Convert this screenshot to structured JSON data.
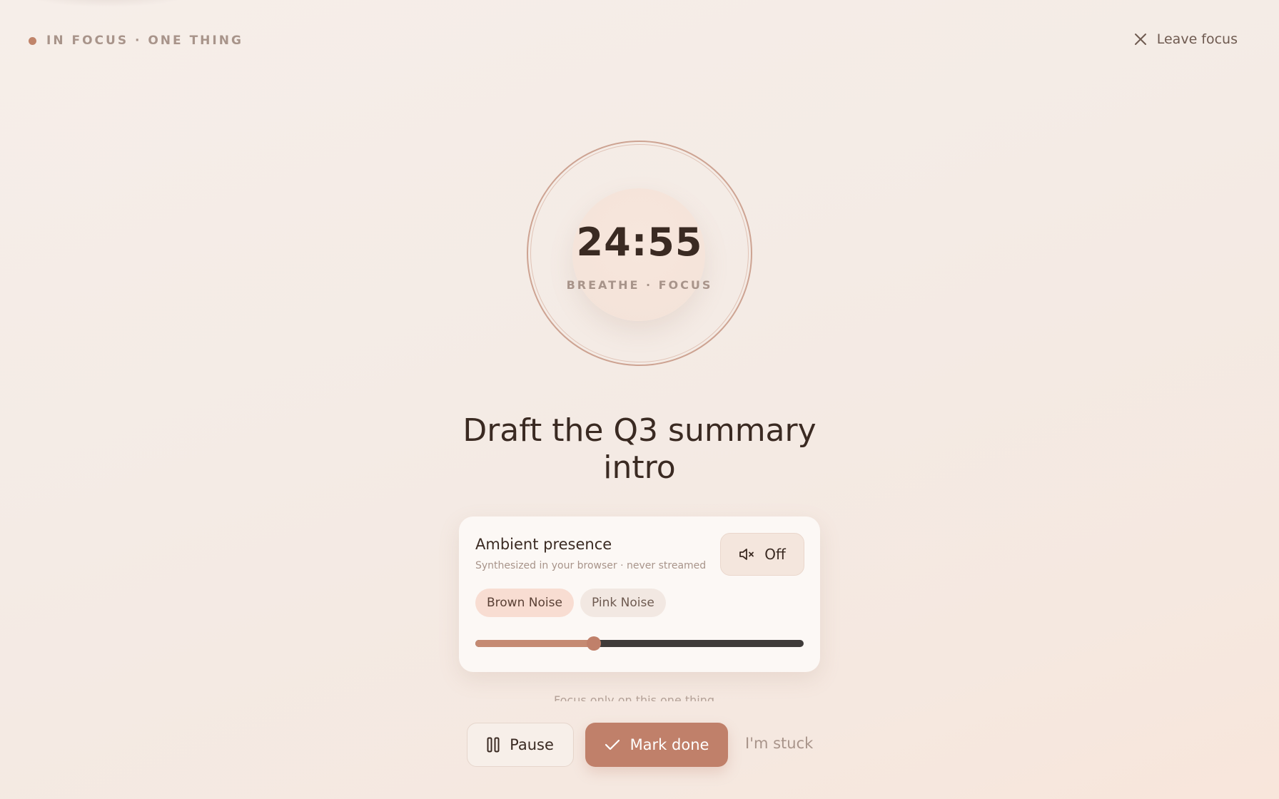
{
  "status": {
    "label": "IN FOCUS · ONE THING",
    "dot_color": "#c0846a"
  },
  "leave": {
    "label": "Leave focus",
    "icon": "close-icon"
  },
  "timer": {
    "time": "24:55",
    "subtitle": "BREATHE · FOCUS"
  },
  "task": {
    "title": "Draft the Q3 summary intro"
  },
  "ambient": {
    "title": "Ambient presence",
    "subtitle": "Synthesized in your browser · never streamed",
    "mute": {
      "label": "Off",
      "icon": "speaker-muted-icon"
    },
    "options": [
      {
        "label": "Brown Noise",
        "selected": true
      },
      {
        "label": "Pink Noise",
        "selected": false
      }
    ],
    "volume": 0.36
  },
  "hint": {
    "text": "Focus only on this one thing"
  },
  "actions": {
    "pause": {
      "label": "Pause",
      "icon": "pause-icon"
    },
    "done": {
      "label": "Mark done",
      "icon": "check-icon"
    },
    "stuck": {
      "label": "I'm stuck"
    }
  },
  "colors": {
    "accent": "#c0806a",
    "text": "#3a2a22",
    "muted": "#a8948a"
  }
}
